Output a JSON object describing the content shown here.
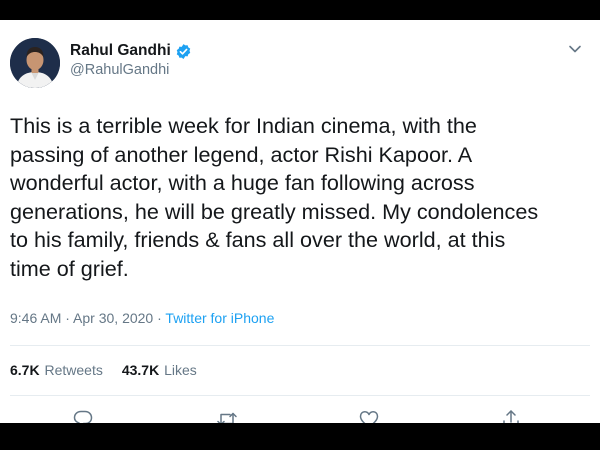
{
  "tweet": {
    "author_name": "Rahul Gandhi",
    "author_handle": "@RahulGandhi",
    "text": "This is a terrible week for Indian cinema, with the\npassing of another legend, actor Rishi Kapoor.  A\nwonderful actor, with a huge fan following across\ngenerations, he will be greatly missed. My condolences\nto his family, friends & fans all over the world, at this\ntime of grief.",
    "time": "9:46 AM",
    "date": "Apr 30, 2020",
    "separator": " · ",
    "source": "Twitter for iPhone"
  },
  "stats": {
    "retweets_count": "6.7K",
    "retweets_label": "Retweets",
    "likes_count": "43.7K",
    "likes_label": "Likes"
  },
  "icons": {
    "verified": "verified-badge-icon",
    "menu": "chevron-down-icon",
    "reply": "reply-icon",
    "retweet": "retweet-icon",
    "like": "heart-icon",
    "share": "share-icon"
  },
  "colors": {
    "text": "#14171a",
    "secondary": "#657786",
    "link": "#1da1f2",
    "divider": "#e6ecf0",
    "letterbox": "#000000"
  }
}
